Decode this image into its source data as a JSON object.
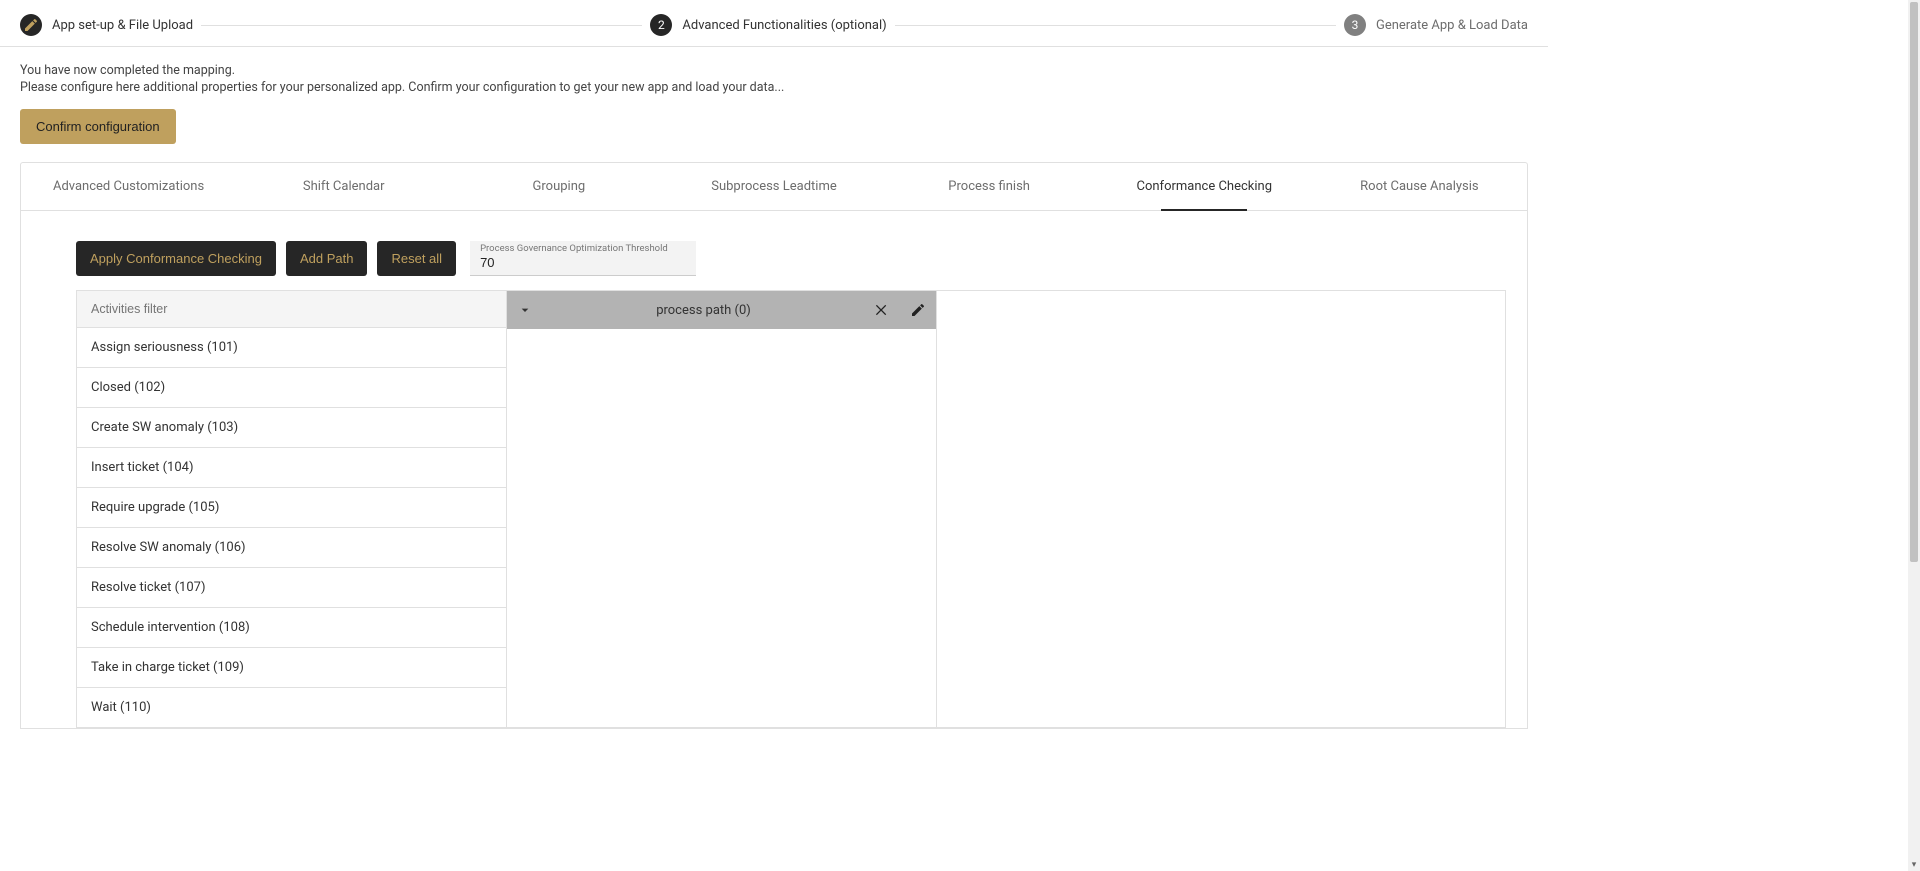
{
  "stepper": {
    "step1_label": "App set-up & File Upload",
    "step2_number": "2",
    "step2_label": "Advanced Functionalities (optional)",
    "step3_number": "3",
    "step3_label": "Generate App & Load Data"
  },
  "intro": {
    "line1": "You have now completed the mapping.",
    "line2": "Please configure here additional properties for your personalized app. Confirm your configuration to get your new app and load your data...",
    "confirm_label": "Confirm configuration"
  },
  "tabs": [
    "Advanced Customizations",
    "Shift Calendar",
    "Grouping",
    "Subprocess Leadtime",
    "Process finish",
    "Conformance Checking",
    "Root Cause Analysis"
  ],
  "active_tab_index": 5,
  "actions": {
    "apply_label": "Apply Conformance Checking",
    "add_path_label": "Add Path",
    "reset_label": "Reset all",
    "threshold_label": "Process Governance Optimization Threshold",
    "threshold_value": "70"
  },
  "activities": {
    "filter_placeholder": "Activities filter",
    "items": [
      "Assign seriousness (101)",
      "Closed (102)",
      "Create SW anomaly (103)",
      "Insert ticket (104)",
      "Require upgrade (105)",
      "Resolve SW anomaly (106)",
      "Resolve ticket (107)",
      "Schedule intervention (108)",
      "Take in charge ticket (109)",
      "Wait (110)"
    ]
  },
  "path_panel": {
    "title": "process path (0)"
  }
}
